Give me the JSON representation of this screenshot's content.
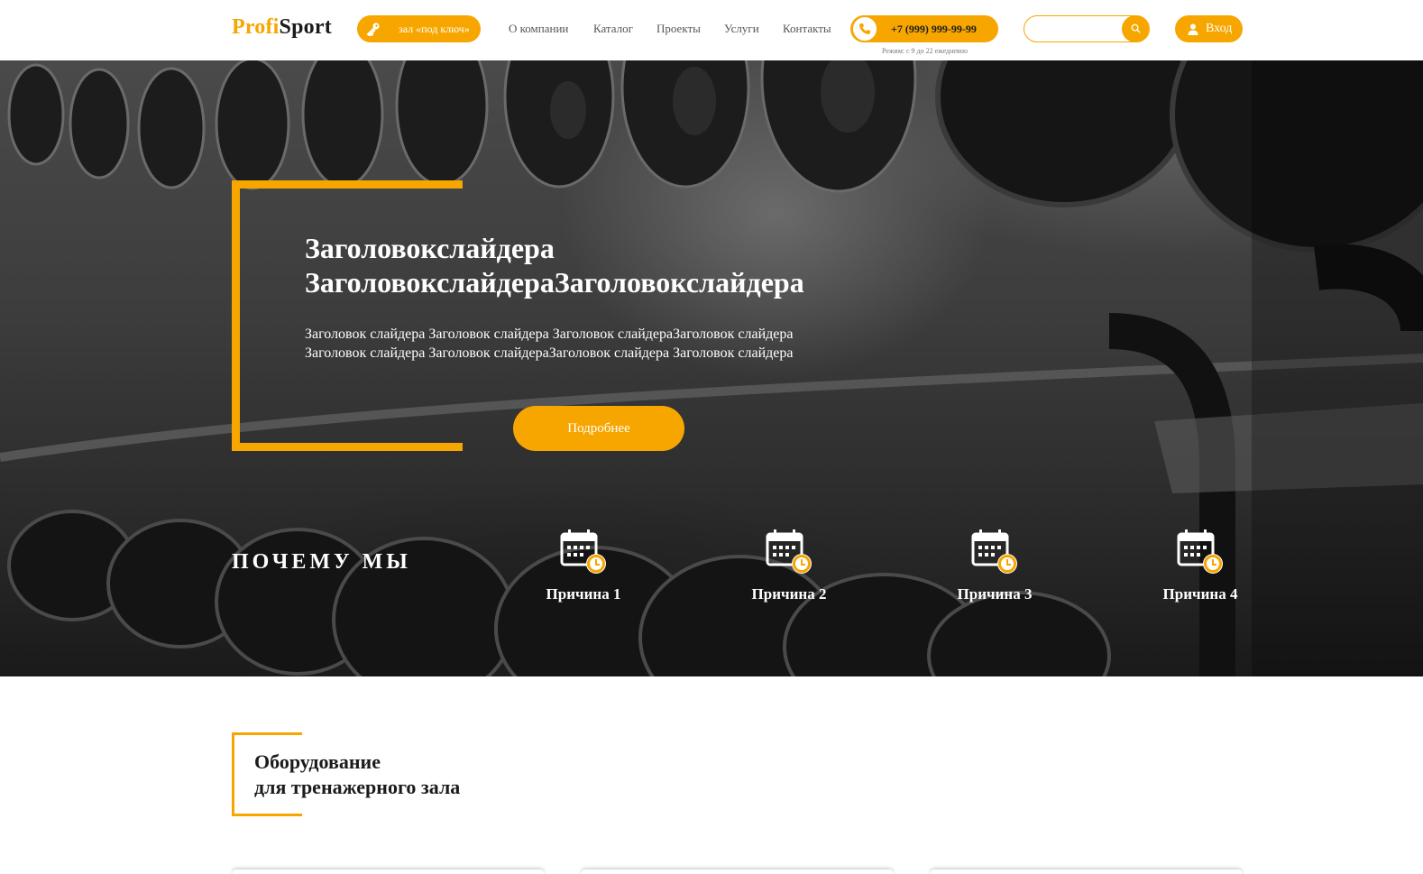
{
  "header": {
    "logo_part1": "Profi",
    "logo_part2": "Sport",
    "turnkey_label": "зал «под ключ»",
    "nav": [
      "О компании",
      "Каталог",
      "Проекты",
      "Услуги",
      "Контакты"
    ],
    "phone": "+7 (999) 999-99-99",
    "hours": "Режим: с 9 до 22 ежедневно",
    "search_placeholder": "",
    "login_label": "Вход"
  },
  "hero": {
    "title_line1": "Заголовокслайдера",
    "title_line2": "ЗаголовокслайдераЗаголовокслайдера",
    "text_line1": "Заголовок слайдера Заголовок слайдера Заголовок слайдераЗаголовок слайдера",
    "text_line2": "Заголовок слайдера Заголовок слайдераЗаголовок слайдера Заголовок слайдера",
    "button_label": "Подробнее"
  },
  "why": {
    "title": "ПОЧЕМУ МЫ",
    "reasons": [
      "Причина 1",
      "Причина 2",
      "Причина 3",
      "Причина 4"
    ]
  },
  "section": {
    "title_line1": "Оборудование",
    "title_line2": "для тренажерного зала"
  },
  "colors": {
    "accent": "#f7a600",
    "dark": "#1b1b1b"
  }
}
